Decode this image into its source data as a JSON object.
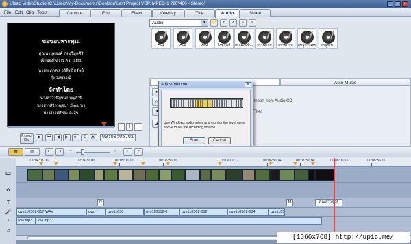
{
  "window": {
    "title": "Ulead VideoStudio (C:\\Users\\My-Documents\\Desktop\\Last Project VSP, MPEG-1 720*480 - Stereo)"
  },
  "menu": [
    "File",
    "Edit",
    "Clip",
    "Tools"
  ],
  "steps": {
    "capture": "Capture",
    "edit": "Edit",
    "effect": "Effect",
    "overlay": "Overlay",
    "title": "Title",
    "audio": "Audio",
    "share": "Share"
  },
  "active_step": "Audio",
  "preview": {
    "heading": "ขอขอบพระคุณ",
    "line1": "คุณนายุพยงค์ กองวิมูลศิริ",
    "line2": "เจ้าของกิจการ NT farm",
    "line3": "นายพ.ภาคร อวิสิทธิ์ทรัพย์",
    "line4": "กู้ทรงคุณวุฒิ",
    "heading2": "จัดทำโดย",
    "line5": "นางสาววรัญชนก บุญลำรี",
    "line6": "นางสาวศิริกาญจนา มีพะนาเร",
    "line7": "นางสาวศศิพิยะ ดงสุข",
    "timecode": "00:08:05.01",
    "mode_label": "Project\nClip",
    "scrub_position": 0.96
  },
  "transport": {
    "play": "▶",
    "home": "⏮",
    "prev": "◀",
    "next": "▶",
    "end": "⏭",
    "repeat": "↻",
    "volume": "🔊"
  },
  "library": {
    "category": "Audio",
    "clips": [
      {
        "label": "A01"
      },
      {
        "label": "A02"
      },
      {
        "label": "A03"
      },
      {
        "label": "low.mp3"
      },
      {
        "label": "uvs11050..."
      },
      {
        "label": "กราฟแกน"
      },
      {
        "label": "กราฟแกน"
      },
      {
        "label": "ดีมลูกเกษตร"
      },
      {
        "label": "ดีกลูกไป..."
      }
    ]
  },
  "options": {
    "tab_left": "Music & Voice",
    "tab_right": "Auto Music",
    "import_cd": "Import from Audio CD",
    "filter": "Filter"
  },
  "dialog": {
    "title": "Adjust Volume",
    "close": "×",
    "message": "Use Windows audio mixer and monitor the level meter above to set the recording volume.",
    "start": "Start",
    "cancel": "Cancel",
    "meter_level": 0.55
  },
  "timeline": {
    "ruler": [
      "00:04:08.00",
      "00:04:30.00",
      "00:05:00.10",
      "00:05:30.10",
      "00:06:00.12",
      "00:06:30.14",
      "00:07:30.14",
      "00:08:00.16",
      "00:08:30.16"
    ],
    "title_clips": [
      "P",
      "M",
      "คุณสาวสุนีย์"
    ],
    "voice_clips": [
      "uvs110502-017.WAV",
      "uvs",
      "uvs11050",
      "uvs110502-0",
      "uvs110502-082",
      "uvs110502-084",
      "uvs110502-0"
    ],
    "music1_clips": [
      "low.mp3",
      "low.mp3"
    ]
  },
  "watermark": "[1366x768] http://upic.me/",
  "colors": {
    "accent": "#3d5f92",
    "storyboard_active": "#f3c650",
    "marker": "#f0a020",
    "playhead": "#e44444",
    "meter_hot": "#ffd21a"
  }
}
